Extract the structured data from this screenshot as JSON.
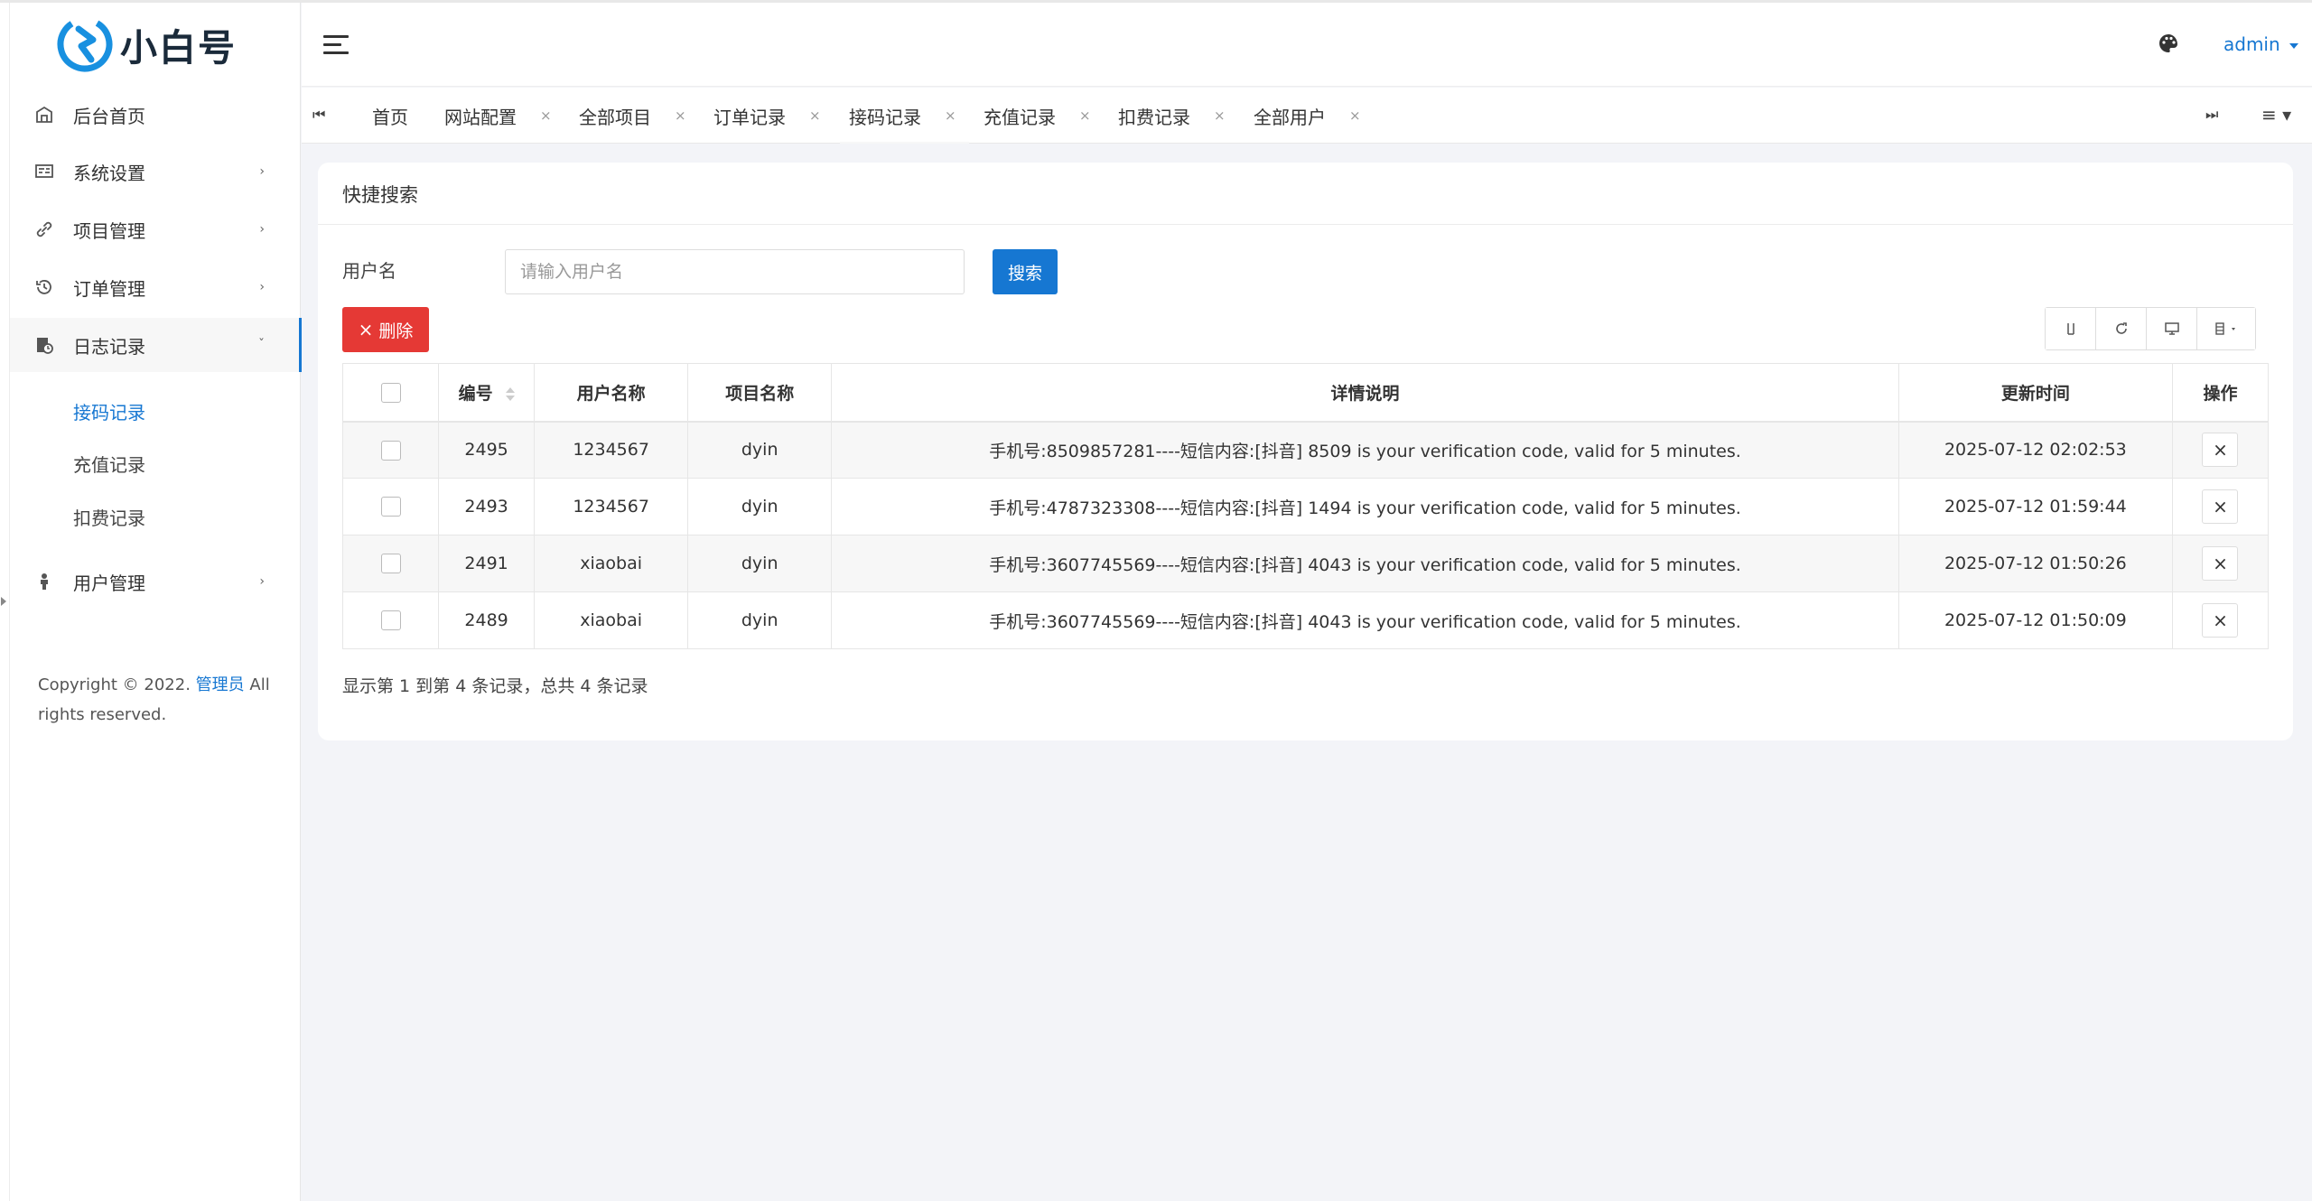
{
  "brand": {
    "name": "小白号"
  },
  "sidebar": {
    "items": [
      {
        "label": "后台首页",
        "icon": "home-icon"
      },
      {
        "label": "系统设置",
        "icon": "settings-panel-icon"
      },
      {
        "label": "项目管理",
        "icon": "link-icon"
      },
      {
        "label": "订单管理",
        "icon": "history-icon"
      },
      {
        "label": "日志记录",
        "icon": "log-icon"
      },
      {
        "label": "用户管理",
        "icon": "user-icon"
      }
    ],
    "subitems": [
      {
        "label": "接码记录"
      },
      {
        "label": "充值记录"
      },
      {
        "label": "扣费记录"
      }
    ],
    "copyright_prefix": "Copyright © 2022. ",
    "copyright_link": "管理员",
    "copyright_suffix": " All rights reserved."
  },
  "header": {
    "user": "admin"
  },
  "tabs": [
    {
      "label": "首页"
    },
    {
      "label": "网站配置"
    },
    {
      "label": "全部项目"
    },
    {
      "label": "订单记录"
    },
    {
      "label": "接码记录"
    },
    {
      "label": "充值记录"
    },
    {
      "label": "扣费记录"
    },
    {
      "label": "全部用户"
    }
  ],
  "search": {
    "title": "快捷搜索",
    "label": "用户名",
    "placeholder": "请输入用户名",
    "value": "",
    "button": "搜索"
  },
  "toolbar": {
    "delete_label": "删除"
  },
  "table": {
    "columns": [
      "编号",
      "用户名称",
      "项目名称",
      "详情说明",
      "更新时间",
      "操作"
    ],
    "rows": [
      {
        "id": "2495",
        "user": "1234567",
        "project": "dyin",
        "detail": "手机号:8509857281----短信内容:[抖音] 8509 is your verification code, valid for 5 minutes.",
        "time": "2025-07-12 02:02:53"
      },
      {
        "id": "2493",
        "user": "1234567",
        "project": "dyin",
        "detail": "手机号:4787323308----短信内容:[抖音] 1494 is your verification code, valid for 5 minutes.",
        "time": "2025-07-12 01:59:44"
      },
      {
        "id": "2491",
        "user": "xiaobai",
        "project": "dyin",
        "detail": "手机号:3607745569----短信内容:[抖音] 4043 is your verification code, valid for 5 minutes.",
        "time": "2025-07-12 01:50:26"
      },
      {
        "id": "2489",
        "user": "xiaobai",
        "project": "dyin",
        "detail": "手机号:3607745569----短信内容:[抖音] 4043 is your verification code, valid for 5 minutes.",
        "time": "2025-07-12 01:50:09"
      }
    ]
  },
  "pagination": {
    "summary": "显示第 1 到第 4 条记录，总共 4 条记录"
  },
  "colors": {
    "accent": "#1677d2",
    "danger": "#e53935"
  }
}
